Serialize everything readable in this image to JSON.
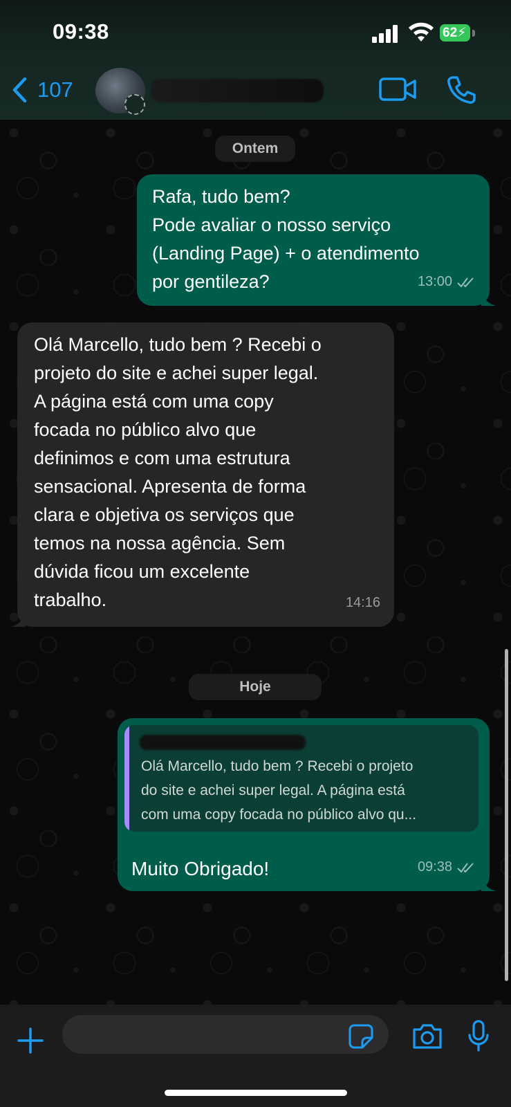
{
  "status_bar": {
    "time": "09:38",
    "battery": "62"
  },
  "header": {
    "back_count": "107",
    "icons": [
      "chevron-left-icon",
      "video-camera-icon",
      "phone-icon"
    ]
  },
  "chat": {
    "date_yesterday": "Ontem",
    "date_today": "Hoje",
    "messages": [
      {
        "direction": "outgoing",
        "text": "Rafa, tudo bem?\nPode avaliar o nosso serviço\n(Landing Page) + o atendimento\npor gentileza?",
        "time": "13:00",
        "status": "read"
      },
      {
        "direction": "incoming",
        "text": "Olá Marcello, tudo bem ? Recebi o\nprojeto do site e achei super legal.\nA página está com uma copy\nfocada no público alvo que\ndefinimos e com uma estrutura\nsensacional. Apresenta de forma\nclara e objetiva os serviços que\ntemos na nossa agência. Sem\ndúvida  ficou um excelente\ntrabalho.",
        "time": "14:16"
      },
      {
        "direction": "outgoing",
        "quote": "Olá Marcello, tudo bem ? Recebi o projeto\ndo site e achei super legal. A página está\ncom uma copy focada no público alvo qu...",
        "text": "Muito Obrigado!",
        "time": "09:38",
        "status": "read"
      }
    ]
  },
  "composer": {
    "placeholder": "",
    "icons": [
      "plus-icon",
      "sticker-icon",
      "camera-icon",
      "microphone-icon"
    ]
  },
  "colors": {
    "outgoing_bubble": "#005c4b",
    "incoming_bubble": "#262628",
    "accent": "#1d9bf0",
    "quote_bar": "#a78bfa"
  }
}
